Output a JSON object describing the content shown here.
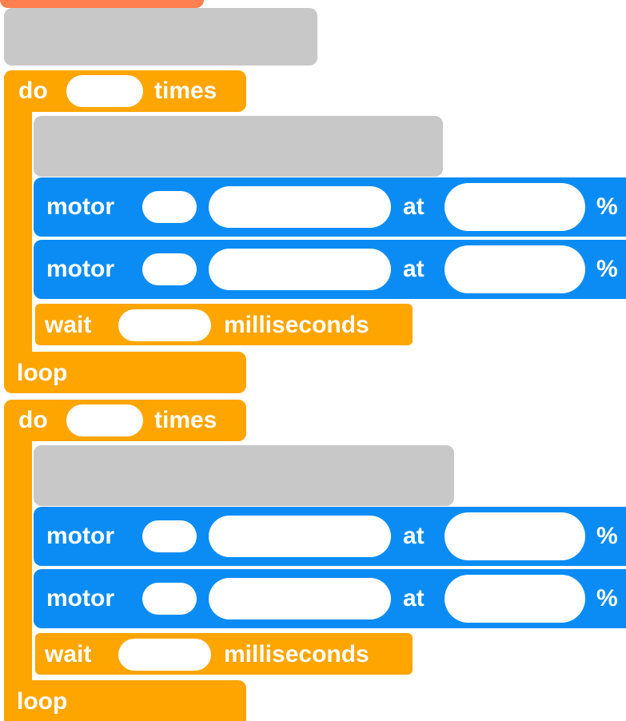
{
  "colors": {
    "control_orange": "#FFA500",
    "motor_blue": "#0B8CF4",
    "placeholder_gray": "#C8C8C8",
    "top_tab": "#FF7F50"
  },
  "blocks": {
    "loop1": {
      "do_label": "do",
      "times_label": "times",
      "motor_rows": [
        {
          "motor_label": "motor",
          "at_label": "at",
          "percent_label": "%"
        },
        {
          "motor_label": "motor",
          "at_label": "at",
          "percent_label": "%"
        }
      ],
      "wait_label": "wait",
      "milliseconds_label": "milliseconds",
      "loop_label": "loop"
    },
    "loop2": {
      "do_label": "do",
      "times_label": "times",
      "motor_rows": [
        {
          "motor_label": "motor",
          "at_label": "at",
          "percent_label": "%"
        },
        {
          "motor_label": "motor",
          "at_label": "at",
          "percent_label": "%"
        }
      ],
      "wait_label": "wait",
      "milliseconds_label": "milliseconds",
      "loop_label": "loop"
    }
  }
}
